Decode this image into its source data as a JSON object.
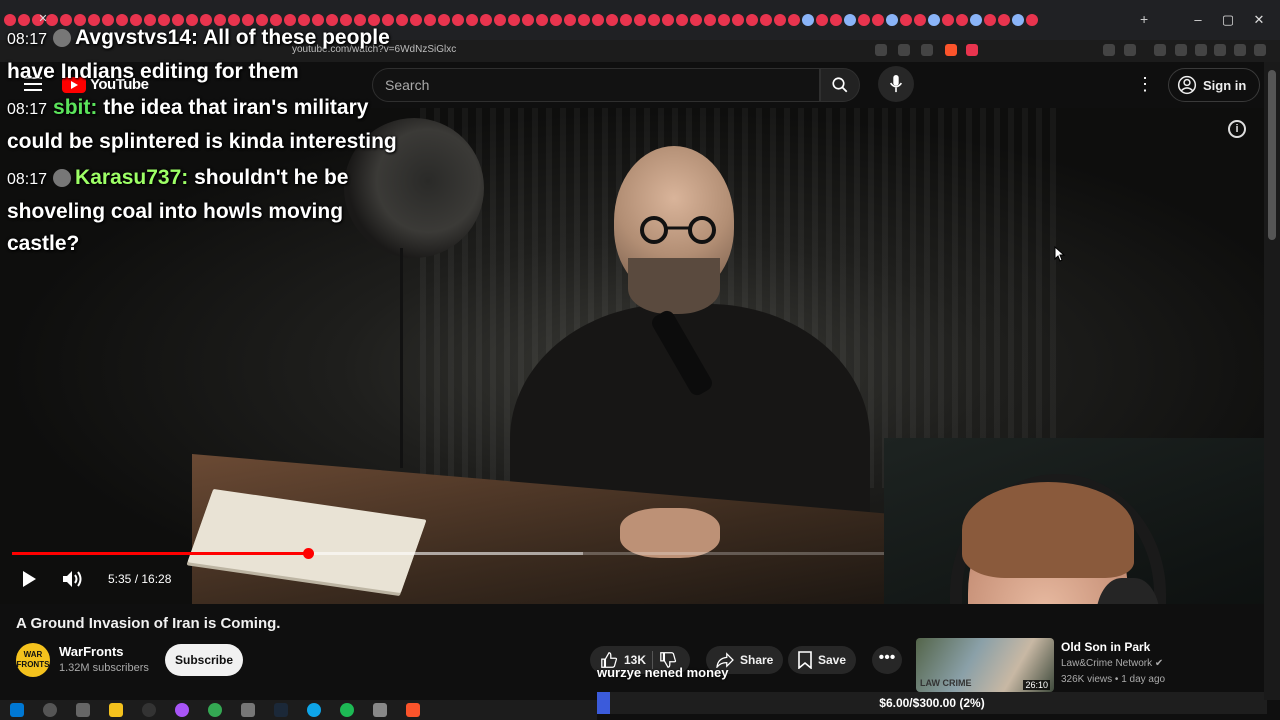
{
  "browser": {
    "url": "youtube.com/watch?v=6WdNzSiGlxc",
    "tab_close": "✕",
    "new_tab": "+",
    "window_controls": [
      "–",
      "▢",
      "✕"
    ]
  },
  "header": {
    "logo_text": "YouTube",
    "search_placeholder": "Search",
    "more_icon": "⋮",
    "signin_label": "Sign in"
  },
  "chat": [
    {
      "time": "08:17",
      "user": "Avgvstvs14",
      "text": "All of these people have Indians editing for them",
      "color": "#ffffff"
    },
    {
      "time": "08:17",
      "user": "sbit",
      "text": "the idea that iran's military could be splintered is kinda interesting",
      "color": "#5be35b"
    },
    {
      "time": "08:17",
      "user": "Karasu737",
      "text": "shouldn't he be shoveling coal into howls moving castle?",
      "color": "#9dff66"
    }
  ],
  "player": {
    "current_time": "5:35",
    "duration": "16:28",
    "timecode": "5:35 / 16:28",
    "played_fraction": 0.339,
    "buffered_fraction": 0.655,
    "info_icon": "i"
  },
  "video": {
    "title": "A Ground Invasion of Iran is Coming.",
    "channel_name": "WarFronts",
    "channel_avatar_text": "WAR FRONTS",
    "subscribers": "1.32M subscribers",
    "subscribe_label": "Subscribe",
    "likes": "13K",
    "share_label": "Share",
    "save_label": "Save",
    "more_label": "•••"
  },
  "recommendation": {
    "title": "Old Son in Park",
    "channel": "Law&Crime Network",
    "meta": "326K views • 1 day ago",
    "duration": "26:10",
    "thumb_text": "LAW CRIME"
  },
  "overlay": {
    "donation_message": "wurzye nened money",
    "goal_text": "$6.00/$300.00 (2%)",
    "goal_fraction": 0.02
  },
  "colors": {
    "accent": "#ff0000",
    "goal": "#3b5bdb"
  },
  "icons": {
    "search": "search-icon",
    "mic": "mic-icon",
    "account": "account-icon",
    "play": "play-icon",
    "volume": "volume-icon",
    "like": "thumbs-up-icon",
    "dislike": "thumbs-down-icon",
    "share": "share-icon",
    "save": "bookmark-icon"
  }
}
